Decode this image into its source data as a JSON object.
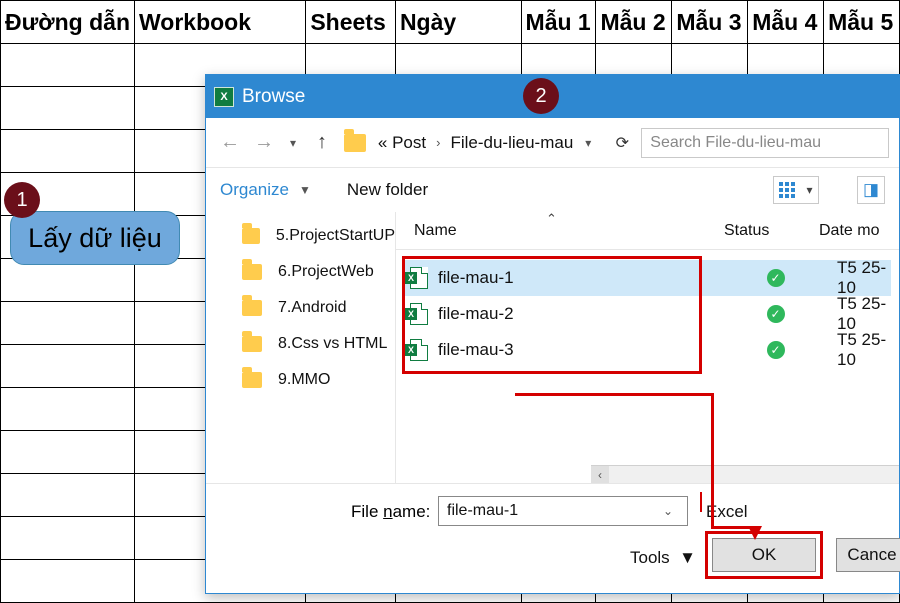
{
  "sheet_headers": [
    "Đường dẫn",
    "Workbook",
    "Sheets",
    "Ngày",
    "Mẫu 1",
    "Mẫu 2",
    "Mẫu 3",
    "Mẫu 4",
    "Mẫu 5"
  ],
  "callout": {
    "badge1": "1",
    "text": "Lấy dữ liệu"
  },
  "badge2": "2",
  "dialog": {
    "title": "Browse",
    "crumbs": {
      "pre": "«  Post",
      "mid": "File-du-lieu-mau"
    },
    "search_placeholder": "Search File-du-lieu-mau",
    "organize": "Organize",
    "newfolder": "New folder",
    "tree": [
      "5.ProjectStartUP",
      "6.ProjectWeb",
      "7.Android",
      "8.Css vs HTML",
      "9.MMO"
    ],
    "columns": {
      "name": "Name",
      "status": "Status",
      "date": "Date mo"
    },
    "files": [
      {
        "name": "file-mau-1",
        "date": "T5 25-10"
      },
      {
        "name": "file-mau-2",
        "date": "T5 25-10"
      },
      {
        "name": "file-mau-3",
        "date": "T5 25-10"
      }
    ],
    "filename_label": "File name:",
    "filename_value": "file-mau-1",
    "filetype": "Excel",
    "tools_label": "Tools",
    "ok": "OK",
    "cancel": "Cance"
  }
}
